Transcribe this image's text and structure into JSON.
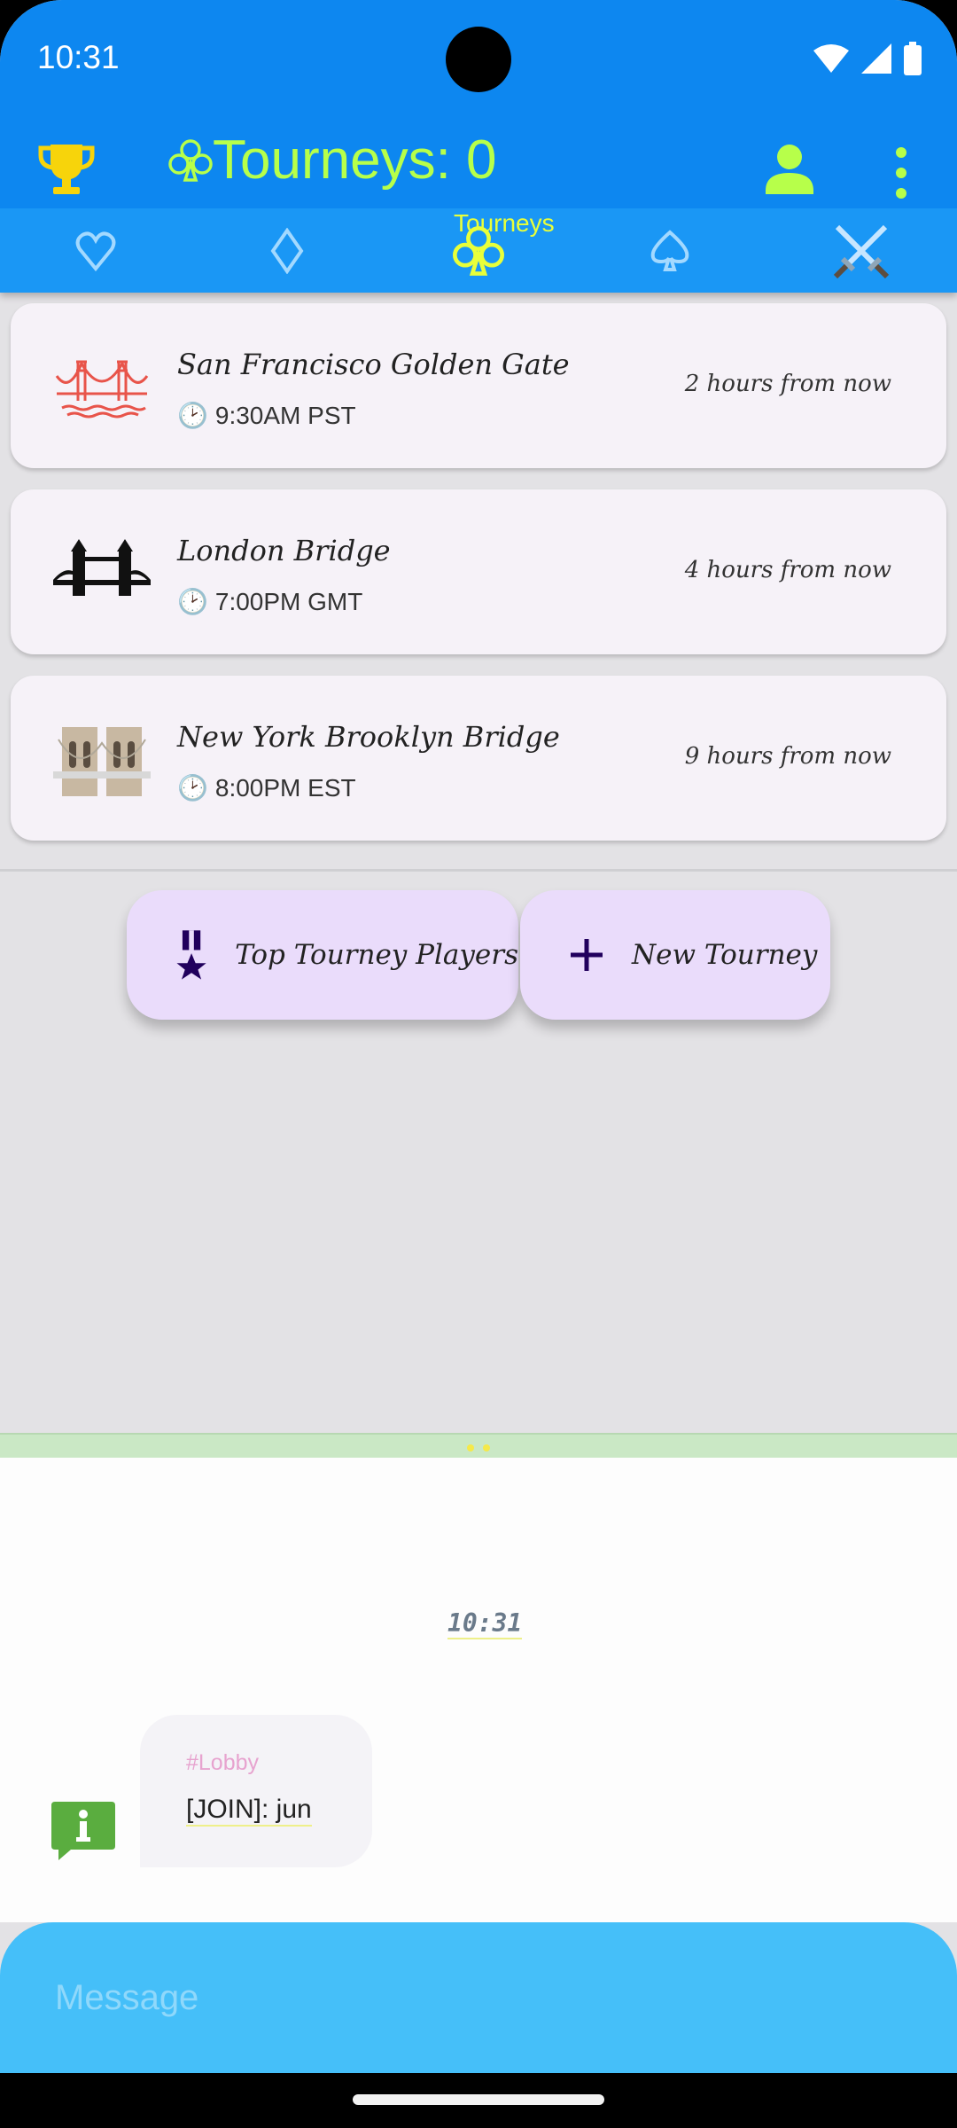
{
  "status_bar": {
    "time": "10:31"
  },
  "app_bar": {
    "title": "Tourneys: 0",
    "icons": {
      "left": "trophy-icon",
      "title_prefix": "club-outline-icon",
      "account": "account-icon",
      "menu": "more-vert-icon"
    }
  },
  "tabs": [
    {
      "icon": "heart-outline-icon",
      "label": ""
    },
    {
      "icon": "diamond-outline-icon",
      "label": ""
    },
    {
      "icon": "club-outline-icon",
      "label": "Tourneys",
      "selected": true
    },
    {
      "icon": "spade-outline-icon",
      "label": ""
    },
    {
      "icon": "crossed-swords-icon",
      "label": ""
    }
  ],
  "tourneys": [
    {
      "name": "San Francisco Golden Gate",
      "time": "9:30AM PST",
      "relative": "2 hours from now",
      "icon": "golden-gate-icon"
    },
    {
      "name": "London Bridge",
      "time": "7:00PM GMT",
      "relative": "4 hours from now",
      "icon": "tower-bridge-icon"
    },
    {
      "name": "New York Brooklyn Bridge",
      "time": "8:00PM EST",
      "relative": "9 hours from now",
      "icon": "brooklyn-bridge-icon"
    }
  ],
  "actions": {
    "top_players": "Top Tourney Players",
    "new_tourney": "New Tourney"
  },
  "chat": {
    "timestamp": "10:31",
    "messages": [
      {
        "channel": "#Lobby",
        "text": "[JOIN]: jun"
      }
    ],
    "input_placeholder": "Message"
  },
  "colors": {
    "header": "#0d87f0",
    "tab_bar": "#1a97f5",
    "title": "#b7ff4a",
    "selected_tab": "#e8ff3a",
    "fab": "#eadcfb",
    "message_bar": "#45bff9"
  }
}
